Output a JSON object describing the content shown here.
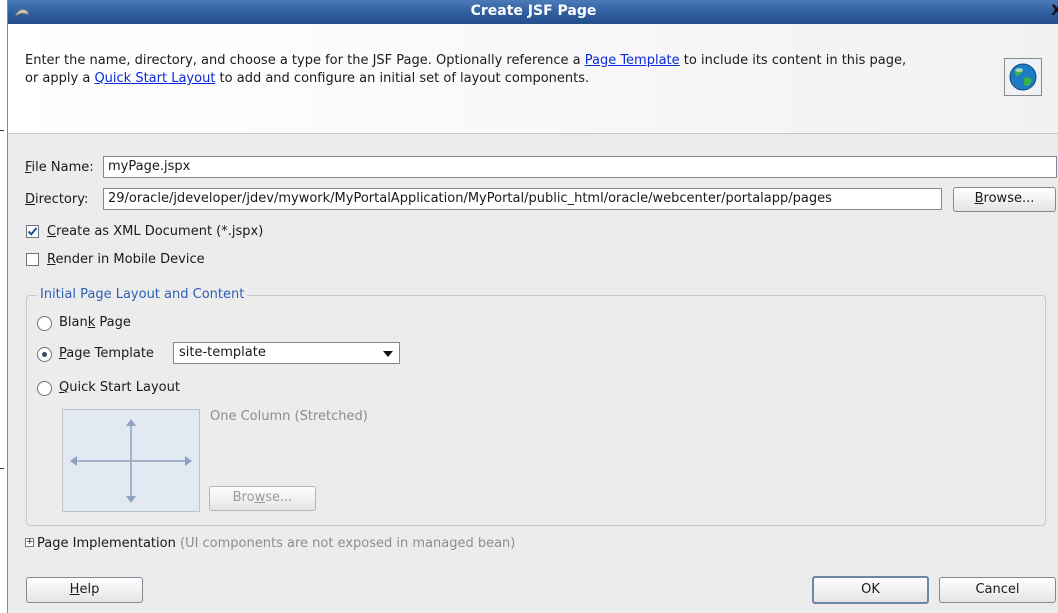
{
  "window": {
    "title": "Create JSF Page",
    "close_glyph": "X"
  },
  "header": {
    "desc_part1": "Enter the name, directory, and choose a type for the JSF Page. Optionally reference a ",
    "link_page_template": "Page Template",
    "desc_part2": " to include its content in this page,",
    "desc_part3": "or apply a ",
    "link_quick_start": "Quick Start Layout",
    "desc_part4": " to add and configure an initial set of layout components."
  },
  "form": {
    "file_name_label_mnemonic": "F",
    "file_name_label_rest": "ile Name:",
    "file_name_value": "myPage.jspx",
    "directory_label_mnemonic": "D",
    "directory_label_rest": "irectory:",
    "directory_value": "29/oracle/jdeveloper/jdev/mywork/MyPortalApplication/MyPortal/public_html/oracle/webcenter/portalapp/pages",
    "browse_mnemonic": "B",
    "browse_rest": "rowse...",
    "create_xml_mnemonic": "C",
    "create_xml_rest": "reate as XML Document (*.jspx)",
    "create_xml_checked": true,
    "render_mobile_mnemonic": "R",
    "render_mobile_rest": "ender in Mobile Device",
    "render_mobile_checked": false
  },
  "layout_group": {
    "legend": "Initial Page Layout and Content",
    "blank_page_pre": "Blan",
    "blank_page_mnemonic": "k",
    "blank_page_post": " Page",
    "page_template_mnemonic": "P",
    "page_template_rest": "age Template",
    "page_template_selected": "site-template",
    "quick_start_mnemonic": "Q",
    "quick_start_rest": "uick Start Layout",
    "selected_option": "page_template",
    "layout_name": "One Column (Stretched)",
    "layout_browse_pre": "Bro",
    "layout_browse_mnemonic": "w",
    "layout_browse_post": "se..."
  },
  "implementation": {
    "expander_glyph": "+",
    "label": "Page Implementation",
    "note": " (UI components are not exposed in managed bean)"
  },
  "buttons": {
    "help_mnemonic": "H",
    "help_rest": "elp",
    "ok": "OK",
    "cancel": "Cancel"
  }
}
